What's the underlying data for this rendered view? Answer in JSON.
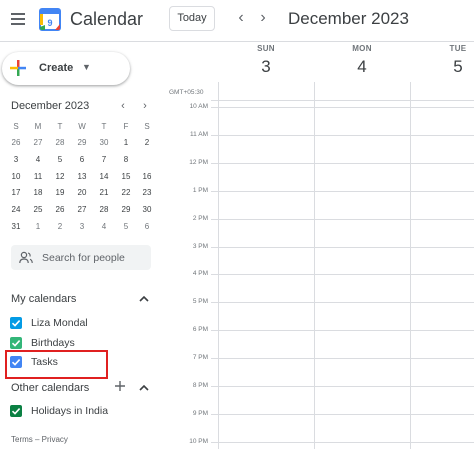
{
  "header": {
    "app_title": "Calendar",
    "logo_day": "9",
    "today_label": "Today",
    "prev_label": "‹",
    "next_label": "›",
    "month_title": "December 2023"
  },
  "sidebar": {
    "create_label": "Create",
    "mini_calendar": {
      "title": "December 2023",
      "prev": "‹",
      "next": "›",
      "weekdays": [
        "S",
        "M",
        "T",
        "W",
        "T",
        "F",
        "S"
      ],
      "weeks": [
        [
          "26",
          "27",
          "28",
          "29",
          "30",
          "1",
          "2"
        ],
        [
          "3",
          "4",
          "5",
          "6",
          "7",
          "8",
          "9"
        ],
        [
          "10",
          "11",
          "12",
          "13",
          "14",
          "15",
          "16"
        ],
        [
          "17",
          "18",
          "19",
          "20",
          "21",
          "22",
          "23"
        ],
        [
          "24",
          "25",
          "26",
          "27",
          "28",
          "29",
          "30"
        ],
        [
          "31",
          "1",
          "2",
          "3",
          "4",
          "5",
          "6"
        ]
      ],
      "today": "9"
    },
    "search_people_placeholder": "Search for people",
    "my_calendars_title": "My calendars",
    "my_calendars": [
      {
        "label": "Liza Mondal",
        "color": "#039be5"
      },
      {
        "label": "Birthdays",
        "color": "#33b679"
      },
      {
        "label": "Tasks",
        "color": "#4285f4"
      }
    ],
    "other_calendars_title": "Other calendars",
    "other_calendars": [
      {
        "label": "Holidays in India",
        "color": "#0b8043"
      }
    ],
    "footer": "Terms – Privacy"
  },
  "main": {
    "timezone": "GMT+05:30",
    "days": [
      {
        "dow": "SUN",
        "num": "3"
      },
      {
        "dow": "MON",
        "num": "4"
      },
      {
        "dow": "TUE",
        "num": "5"
      }
    ],
    "hours": [
      "10 AM",
      "11 AM",
      "12 PM",
      "1 PM",
      "2 PM",
      "3 PM",
      "4 PM",
      "5 PM",
      "6 PM",
      "7 PM",
      "8 PM",
      "9 PM",
      "10 PM"
    ]
  },
  "colors": {
    "accent": "#1a73e8",
    "highlight": "#e02020"
  }
}
